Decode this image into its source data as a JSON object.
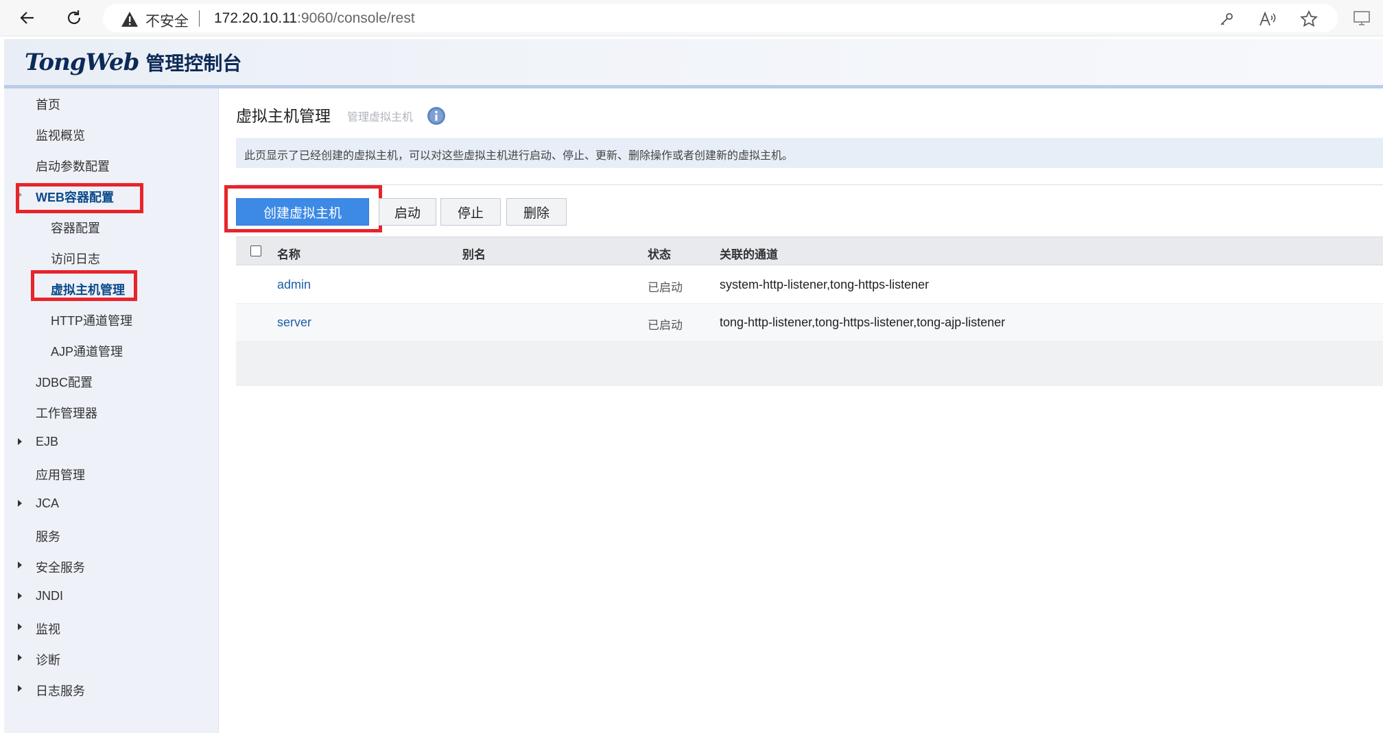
{
  "browser": {
    "insecure_label": "不安全",
    "url_host": "172.20.10.11",
    "url_rest": ":9060/console/rest"
  },
  "app": {
    "logo_text": "TongWeb",
    "logo_suffix": "管理控制台"
  },
  "sidebar": {
    "items": [
      {
        "label": "首页"
      },
      {
        "label": "监视概览"
      },
      {
        "label": "启动参数配置"
      },
      {
        "label": "WEB容器配置"
      },
      {
        "label": "容器配置"
      },
      {
        "label": "访问日志"
      },
      {
        "label": "虚拟主机管理"
      },
      {
        "label": "HTTP通道管理"
      },
      {
        "label": "AJP通道管理"
      },
      {
        "label": "JDBC配置"
      },
      {
        "label": "工作管理器"
      },
      {
        "label": "EJB"
      },
      {
        "label": "应用管理"
      },
      {
        "label": "JCA"
      },
      {
        "label": "服务"
      },
      {
        "label": "安全服务"
      },
      {
        "label": "JNDI"
      },
      {
        "label": "监视"
      },
      {
        "label": "诊断"
      },
      {
        "label": "日志服务"
      }
    ]
  },
  "page": {
    "title": "虚拟主机管理",
    "subtitle": "管理虚拟主机",
    "description": "此页显示了已经创建的虚拟主机，可以对这些虚拟主机进行启动、停止、更新、删除操作或者创建新的虚拟主机。"
  },
  "toolbar": {
    "create_label": "创建虚拟主机",
    "start_label": "启动",
    "stop_label": "停止",
    "delete_label": "删除"
  },
  "table": {
    "headers": {
      "name": "名称",
      "alias": "别名",
      "status": "状态",
      "channels": "关联的通道"
    },
    "rows": [
      {
        "name": "admin",
        "alias": "",
        "status": "已启动",
        "channels": "system-http-listener,tong-https-listener"
      },
      {
        "name": "server",
        "alias": "",
        "status": "已启动",
        "channels": "tong-http-listener,tong-https-listener,tong-ajp-listener"
      }
    ]
  },
  "colors": {
    "highlight": "#e8242b",
    "primary": "#3d8ae6",
    "link": "#1b5fa8"
  }
}
